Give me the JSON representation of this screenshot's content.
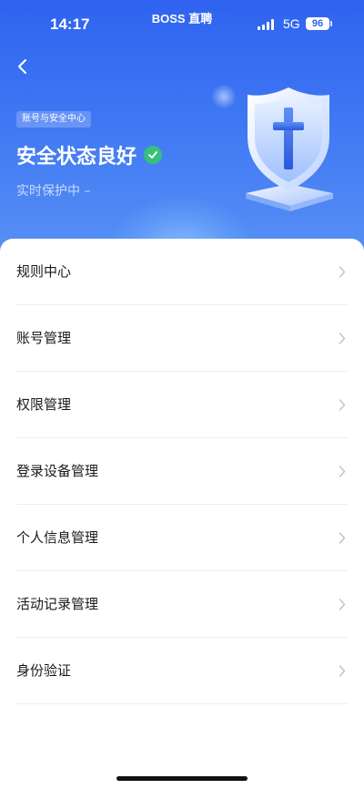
{
  "status_bar": {
    "time": "14:17",
    "carrier": "BOSS 直聘",
    "network": "5G",
    "battery": "96"
  },
  "header": {
    "badge": "账号与安全中心",
    "title": "安全状态良好",
    "subtitle": "实时保护中 –"
  },
  "menu": {
    "items": [
      {
        "label": "规则中心"
      },
      {
        "label": "账号管理"
      },
      {
        "label": "权限管理"
      },
      {
        "label": "登录设备管理"
      },
      {
        "label": "个人信息管理"
      },
      {
        "label": "活动记录管理"
      },
      {
        "label": "身份验证"
      }
    ]
  },
  "colors": {
    "header_top": "#2f63f0",
    "header_bottom": "#5a93f5",
    "status_ok": "#36c07a"
  }
}
